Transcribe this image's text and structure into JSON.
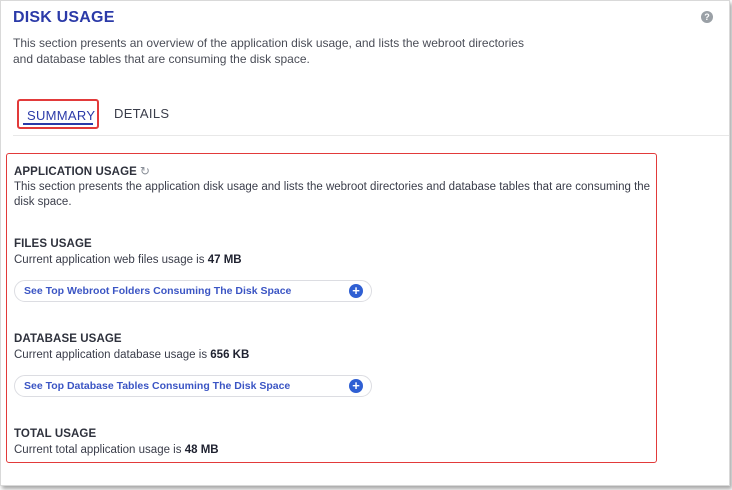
{
  "header": {
    "title": "DISK USAGE",
    "description": "This section presents an overview of the application disk usage, and lists the webroot directories and database tables that are consuming the disk space.",
    "help_icon": "?"
  },
  "tabs": [
    {
      "label": "SUMMARY",
      "active": true
    },
    {
      "label": "DETAILS",
      "active": false
    }
  ],
  "application_usage": {
    "title": "APPLICATION USAGE",
    "refresh_icon": "↻",
    "description": "This section presents the application disk usage and lists the webroot directories and database tables that are consuming the disk space."
  },
  "files_usage": {
    "title": "FILES USAGE",
    "text": "Current application web files usage is",
    "value": "47 MB",
    "button_label": "See Top Webroot Folders Consuming The Disk Space"
  },
  "database_usage": {
    "title": "DATABASE USAGE",
    "text": "Current application database usage is",
    "value": "656 KB",
    "button_label": "See Top Database Tables Consuming The Disk Space"
  },
  "total_usage": {
    "title": "TOTAL USAGE",
    "text": "Current total application usage is",
    "value": "48 MB"
  },
  "plus_icon": "+",
  "colors": {
    "title": "#2b3aa8",
    "highlight": "#e23a3a",
    "link": "#3b55c4",
    "plus": "#2f5fd3"
  }
}
